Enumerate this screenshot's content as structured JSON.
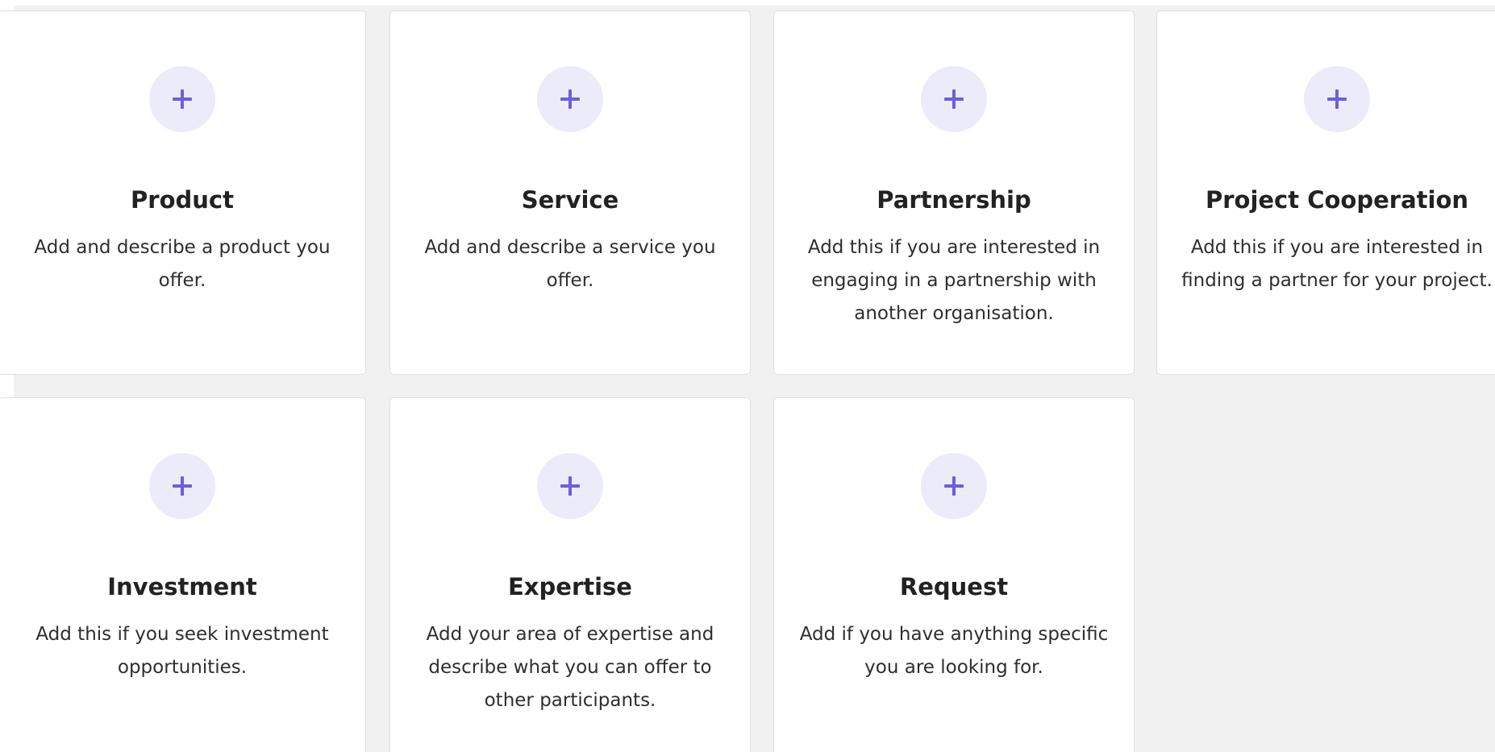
{
  "colors": {
    "accent": "#6a5fdc",
    "accent_bg": "#ecebfa",
    "page_bg": "#f1f1f1",
    "card_bg": "#ffffff",
    "card_border": "#dedede",
    "title_text": "#222222",
    "body_text": "#2e2e2e"
  },
  "cards": [
    {
      "icon": "plus-icon",
      "title": "Product",
      "description": "Add and describe a product you offer."
    },
    {
      "icon": "plus-icon",
      "title": "Service",
      "description": "Add and describe a service you offer."
    },
    {
      "icon": "plus-icon",
      "title": "Partnership",
      "description": "Add this if you are interested in engaging in a partnership with another organisation."
    },
    {
      "icon": "plus-icon",
      "title": "Project Cooperation",
      "description": "Add this if you are interested in finding a partner for your project."
    },
    {
      "icon": "plus-icon",
      "title": "Investment",
      "description": "Add this if you seek investment opportunities."
    },
    {
      "icon": "plus-icon",
      "title": "Expertise",
      "description": "Add your area of expertise and describe what you can offer to other participants."
    },
    {
      "icon": "plus-icon",
      "title": "Request",
      "description": "Add if you have anything specific you are looking for."
    }
  ]
}
